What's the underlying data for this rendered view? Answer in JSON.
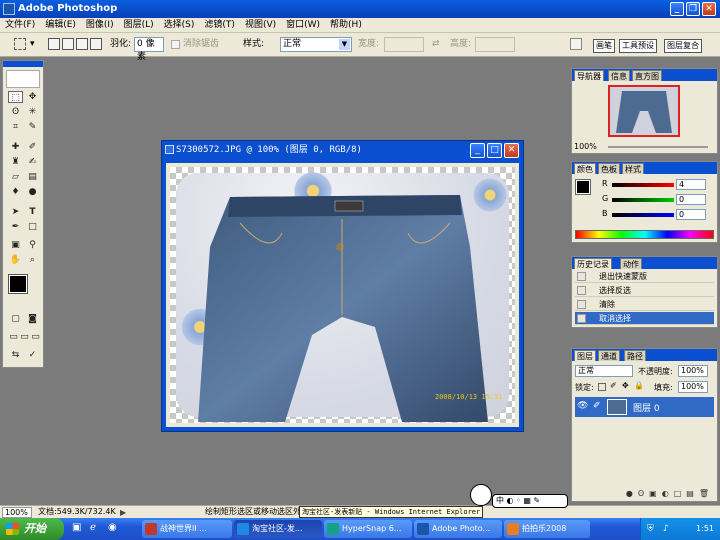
{
  "app": {
    "title": "Adobe Photoshop"
  },
  "menu": [
    "文件(F)",
    "编辑(E)",
    "图像(I)",
    "图层(L)",
    "选择(S)",
    "滤镜(T)",
    "视图(V)",
    "窗口(W)",
    "帮助(H)"
  ],
  "options_bar": {
    "feather_label": "羽化:",
    "feather_value": "0 像素",
    "antialias_label": "消除锯齿",
    "style_label": "样式:",
    "style_value": "正常",
    "width_label": "宽度:",
    "height_label": "高度:",
    "palette_tabs": [
      "画笔",
      "工具预设",
      "图层复合"
    ]
  },
  "document": {
    "title": "S7300572.JPG @ 100% (图层 0, RGB/8)",
    "date_stamp": "2008/10/13 15:31"
  },
  "navigator": {
    "tabs": [
      "导航器",
      "信息",
      "直方图"
    ],
    "zoom": "100%"
  },
  "color_panel": {
    "tabs": [
      "颜色",
      "色板",
      "样式"
    ],
    "channels": [
      {
        "label": "R",
        "value": "4",
        "color": "#b00000"
      },
      {
        "label": "G",
        "value": "0",
        "color": "#008000"
      },
      {
        "label": "B",
        "value": "0",
        "color": "#0000b0"
      }
    ]
  },
  "history_panel": {
    "tabs": [
      "历史记录",
      "动作"
    ],
    "items": [
      "退出快速蒙版",
      "选择反选",
      "清除",
      "取消选择"
    ],
    "selected_index": 3
  },
  "layers_panel": {
    "tabs": [
      "图层",
      "通道",
      "路径"
    ],
    "blend_mode": "正常",
    "opacity_label": "不透明度:",
    "opacity_value": "100%",
    "lock_label": "锁定:",
    "fill_label": "填充:",
    "fill_value": "100%",
    "layers": [
      {
        "name": "图层 0"
      }
    ]
  },
  "status_bar": {
    "zoom": "100%",
    "doc_size": "文档:549.3K/732.4K",
    "hint": "绘制矩形选区或移动选区外框。要用附加选项，使用 Shift、Alt 和 Ctrl 键。",
    "tooltip": "淘宝社区-发表新贴 - Windows Internet Explorer"
  },
  "taskbar": {
    "start": "开始",
    "tasks": [
      {
        "label": "战神世界II ...",
        "color": "#c0392b"
      },
      {
        "label": "淘宝社区-发...",
        "color": "#1e88e5"
      },
      {
        "label": "HyperSnap 6...",
        "color": "#16a085"
      },
      {
        "label": "Adobe Photo...",
        "color": "#1b57a8"
      },
      {
        "label": "拍拍乐2008",
        "color": "#e67e22"
      }
    ],
    "clock": "1:51"
  }
}
